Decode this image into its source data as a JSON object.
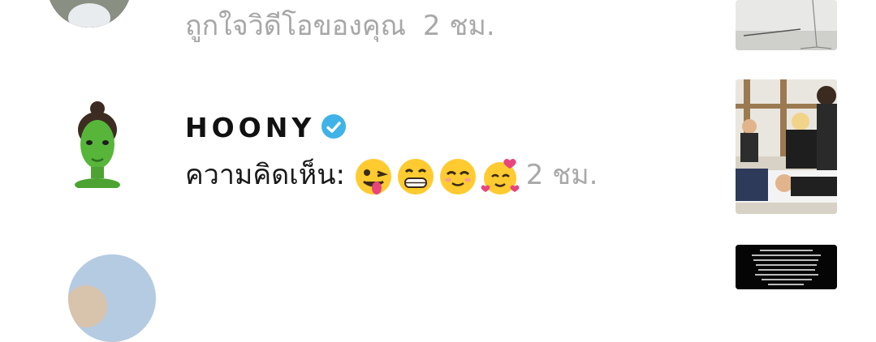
{
  "notifications": [
    {
      "avatar": "user-photo-avatar",
      "message": "ถูกใจวิดีโอของคุณ",
      "time": "2 ชม.",
      "thumbnail": "studio-floor-thumbnail"
    },
    {
      "avatar": "green-memoji-avatar",
      "username": "HOONY",
      "verified": true,
      "message": "ความคิดเห็น:",
      "emojis": [
        "winking-tongue-emoji",
        "grinning-emoji",
        "smiling-eyes-emoji",
        "smiling-hearts-emoji"
      ],
      "time": "2 ชม.",
      "thumbnail": "group-photo-thumbnail"
    },
    {
      "avatar": "sky-photo-avatar",
      "thumbnail": "dark-text-thumbnail"
    }
  ],
  "colors": {
    "verified": "#3fb3e8",
    "muted_text": "#a7a7a7"
  }
}
